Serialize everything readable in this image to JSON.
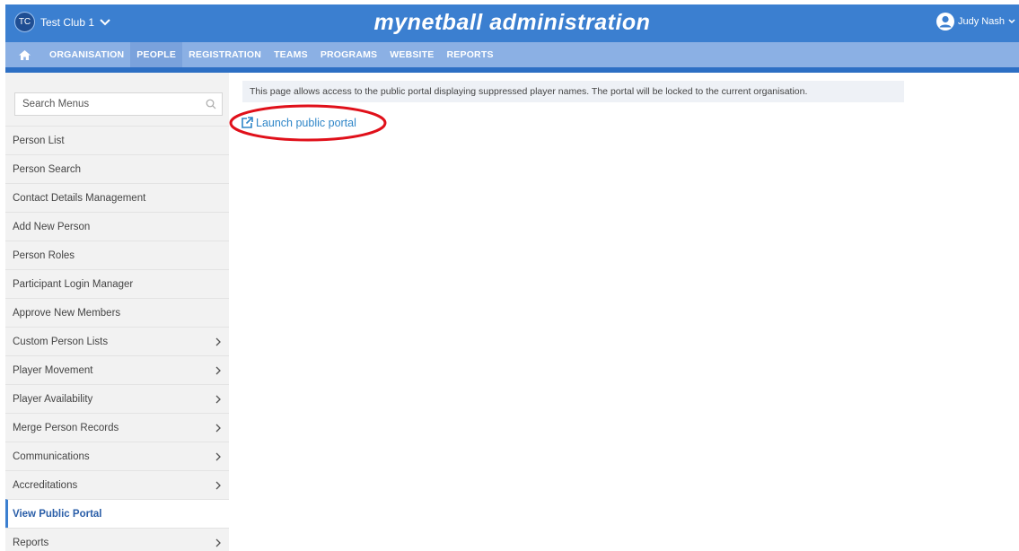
{
  "header": {
    "club_initials": "TC",
    "club_name": "Test Club 1",
    "app_title": "mynetball administration",
    "user_name": "Judy Nash",
    "brand_color": "#3b7fd0"
  },
  "nav": {
    "home_icon": "home-icon",
    "items": [
      {
        "label": "ORGANISATION"
      },
      {
        "label": "PEOPLE",
        "active": true
      },
      {
        "label": "REGISTRATION"
      },
      {
        "label": "TEAMS"
      },
      {
        "label": "PROGRAMS"
      },
      {
        "label": "WEBSITE"
      },
      {
        "label": "REPORTS"
      }
    ]
  },
  "sidebar": {
    "search_placeholder": "Search Menus",
    "items": [
      {
        "label": "Person List",
        "has_submenu": false
      },
      {
        "label": "Person Search",
        "has_submenu": false
      },
      {
        "label": "Contact Details Management",
        "has_submenu": false
      },
      {
        "label": "Add New Person",
        "has_submenu": false
      },
      {
        "label": "Person Roles",
        "has_submenu": false
      },
      {
        "label": "Participant Login Manager",
        "has_submenu": false
      },
      {
        "label": "Approve New Members",
        "has_submenu": false
      },
      {
        "label": "Custom Person Lists",
        "has_submenu": true
      },
      {
        "label": "Player Movement",
        "has_submenu": true
      },
      {
        "label": "Player Availability",
        "has_submenu": true
      },
      {
        "label": "Merge Person Records",
        "has_submenu": true
      },
      {
        "label": "Communications",
        "has_submenu": true
      },
      {
        "label": "Accreditations",
        "has_submenu": true
      },
      {
        "label": "View Public Portal",
        "has_submenu": false,
        "active": true
      },
      {
        "label": "Reports",
        "has_submenu": true
      }
    ]
  },
  "main": {
    "info_text": "This page allows access to the public portal displaying suppressed player names. The portal will be locked to the current organisation.",
    "launch_label": "Launch public portal",
    "launch_icon": "external-link-icon",
    "annotation_color": "#e0101a"
  }
}
